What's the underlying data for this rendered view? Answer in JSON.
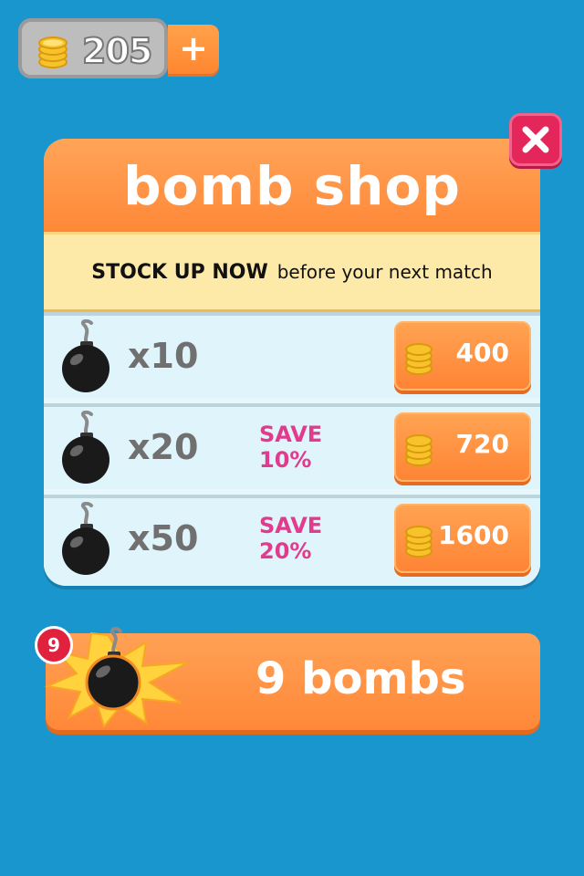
{
  "wallet": {
    "coins": "205",
    "add_label": "+",
    "coin_icon": "coin-stack-icon"
  },
  "shop": {
    "title": "bomb shop",
    "banner_bold": "STOCK UP NOW",
    "banner_text": "before your next match",
    "close_icon": "close-icon",
    "items": [
      {
        "quantity": "x10",
        "save_line1": "",
        "save_line2": "",
        "price": "400"
      },
      {
        "quantity": "x20",
        "save_line1": "SAVE",
        "save_line2": "10%",
        "price": "720"
      },
      {
        "quantity": "x50",
        "save_line1": "SAVE",
        "save_line2": "20%",
        "price": "1600"
      }
    ]
  },
  "inventory": {
    "badge": "9",
    "label": "9 bombs",
    "icon": "bomb-icon"
  },
  "colors": {
    "background": "#1a96cf",
    "accent": "#ff8838",
    "save_text": "#e23a8d",
    "close": "#e4265a"
  }
}
